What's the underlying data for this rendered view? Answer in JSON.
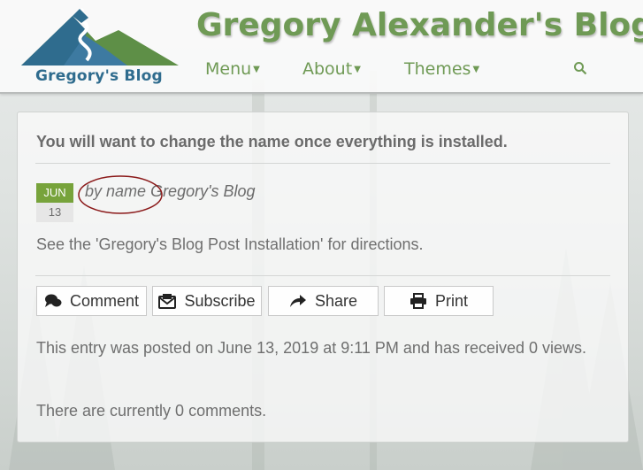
{
  "header": {
    "logo_text": "Gregory's Blog",
    "blog_title": "Gregory Alexander's Blog",
    "nav": [
      {
        "label": "Menu"
      },
      {
        "label": "About"
      },
      {
        "label": "Themes"
      }
    ],
    "search_icon": "search-icon"
  },
  "post": {
    "title": "You will want to change the name once everything is installed.",
    "date": {
      "month": "JUN",
      "day": "13"
    },
    "byline_prefix": "by name",
    "author": "Gregory's Blog",
    "body": "See the 'Gregory's Blog Post Installation' for directions.",
    "actions": [
      {
        "label": "Comment",
        "icon": "comment-icon"
      },
      {
        "label": "Subscribe",
        "icon": "subscribe-icon"
      },
      {
        "label": "Share",
        "icon": "share-icon"
      },
      {
        "label": "Print",
        "icon": "print-icon"
      }
    ],
    "meta": "This entry was posted on June 13, 2019 at 9:11 PM and has received 0 views.",
    "comments_text": "There are currently 0 comments."
  },
  "colors": {
    "brand_green": "#6f9a55",
    "date_green": "#77a33b",
    "logo_blue": "#2f6c8e",
    "annotation_red": "#8b1a1a"
  }
}
